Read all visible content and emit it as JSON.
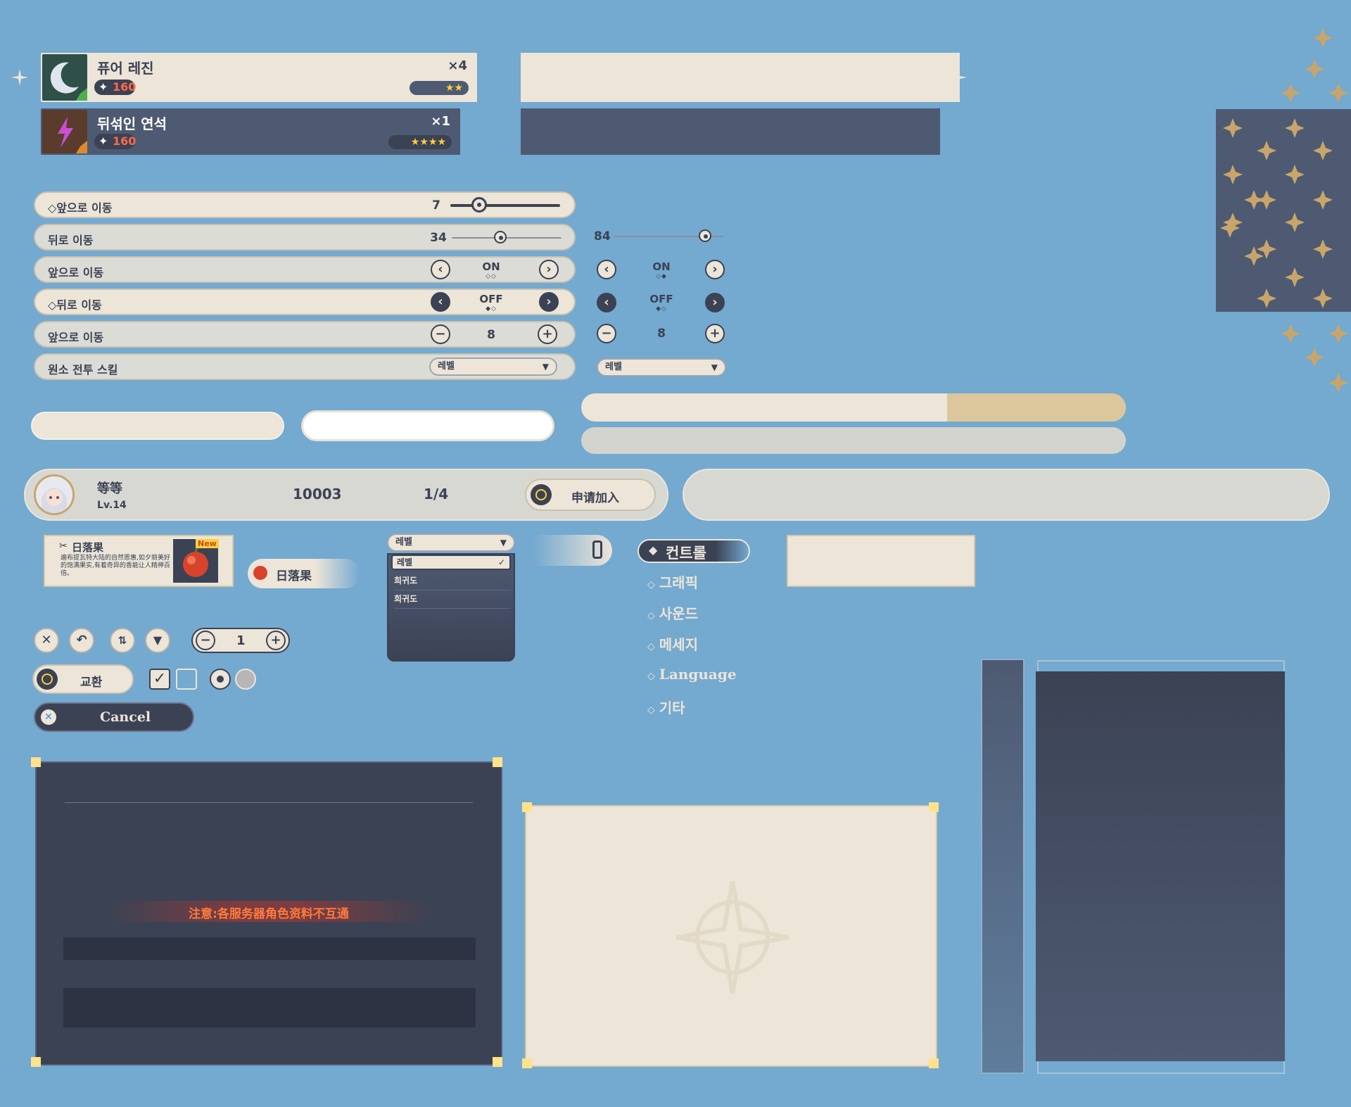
{
  "items": [
    {
      "name": "퓨어 레진",
      "count": "×4",
      "cost": "160",
      "stars": "★★"
    },
    {
      "name": "뒤섞인 연석",
      "count": "×1",
      "cost": "160",
      "stars": "★★★★"
    }
  ],
  "settings": [
    {
      "label": "◇앞으로 이동",
      "value": "7"
    },
    {
      "label": "뒤로 이동",
      "value": "34",
      "alt_value": "84"
    },
    {
      "label": "앞으로 이동",
      "value": "ON",
      "alt_value": "ON"
    },
    {
      "label": "◇뒤로 이동",
      "value": "OFF",
      "alt_value": "OFF"
    },
    {
      "label": "앞으로 이동",
      "value": "8",
      "alt_value": "8"
    },
    {
      "label": "원소 전투 스킬",
      "value": "레벨",
      "alt_value": "레벨"
    }
  ],
  "player": {
    "name": "等等",
    "level": "Lv.14",
    "uid": "10003",
    "members": "1/4",
    "join_label": "申请加入"
  },
  "sunsettia": {
    "title": "日落果",
    "badge": "New",
    "desc": "遍布提瓦特大陆的自然恩惠,如夕丽美好的饱满果实,有着奇异的香能让人精神百倍。",
    "chip_label": "日落果"
  },
  "dropdown_list": {
    "selected": "레벨",
    "options": [
      "레벨",
      "희귀도",
      "희귀도"
    ]
  },
  "menu": {
    "active": "컨트롤",
    "items": [
      "그래픽",
      "사운드",
      "메세지",
      "Language",
      "기타"
    ]
  },
  "toolbar": {
    "quantity": "1",
    "minus": "−",
    "plus": "+"
  },
  "buttons": {
    "exchange": "교환",
    "cancel": "Cancel"
  },
  "dialog": {
    "notice": "注意:各服务器角色资料不互通"
  },
  "colors": {
    "cream": "#ece5d8",
    "slate": "#4e5a72",
    "dark": "#3b4254",
    "gold": "#c8a56a",
    "background": "#74a9d0",
    "accent_red": "#ff6a4a"
  }
}
